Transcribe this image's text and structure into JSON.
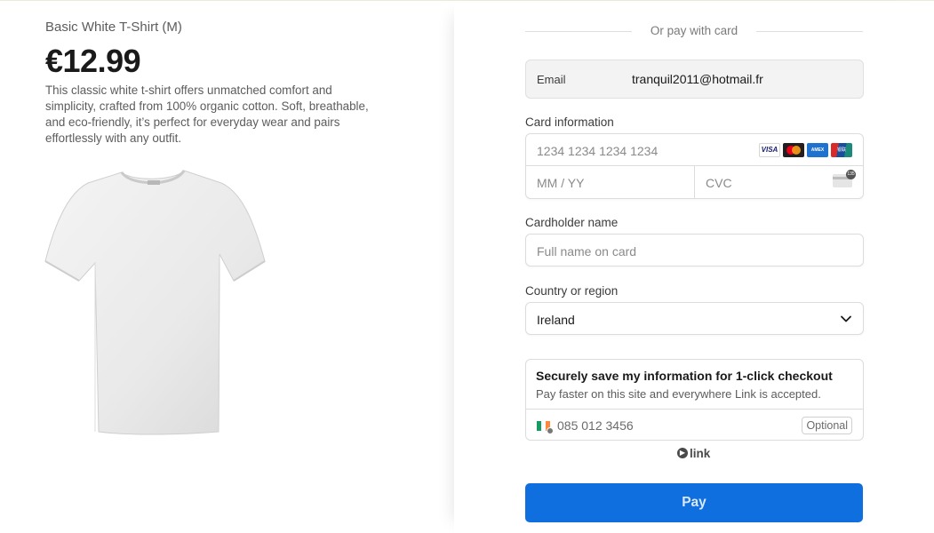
{
  "product": {
    "name": "Basic White T-Shirt (M)",
    "price": "€12.99",
    "description": "This classic white t-shirt offers unmatched comfort and simplicity, crafted from 100% organic cotton. Soft, breathable, and eco-friendly, it’s perfect for everyday wear and pairs effortlessly with any outfit.",
    "image_alt": "Basic White T-Shirt"
  },
  "checkout": {
    "divider_text": "Or pay with card",
    "email": {
      "label": "Email",
      "value": "tranquil2011@hotmail.fr"
    },
    "card": {
      "label": "Card information",
      "number_placeholder": "1234 1234 1234 1234",
      "expiry_placeholder": "MM / YY",
      "cvc_placeholder": "CVC",
      "brands": [
        "visa",
        "mastercard",
        "amex",
        "unionpay"
      ],
      "brand_visa_text": "VISA",
      "cvc_icon_text": "135"
    },
    "cardholder": {
      "label": "Cardholder name",
      "placeholder": "Full name on card"
    },
    "country": {
      "label": "Country or region",
      "value": "Ireland"
    },
    "link": {
      "title": "Securely save my information for 1-click checkout",
      "subtitle": "Pay faster on this site and everywhere Link is accepted.",
      "phone_placeholder": "085 012 3456",
      "optional_label": "Optional",
      "flag": "ireland-flag-icon",
      "logo_text": "link"
    },
    "pay_label": "Pay",
    "colors": {
      "pay_button": "#0f6fde",
      "text": "#1a1a1a",
      "muted": "#5c5c5c",
      "border": "#dcdcdc"
    }
  }
}
